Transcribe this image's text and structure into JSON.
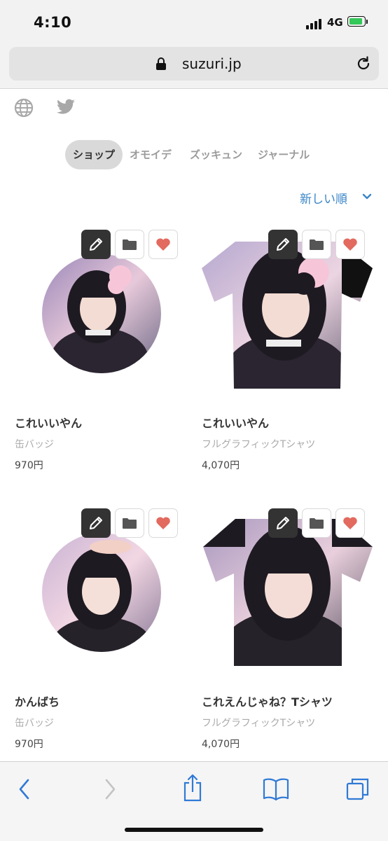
{
  "status": {
    "time": "4:10",
    "network": "4G"
  },
  "browser": {
    "url": "suzuri.jp"
  },
  "social": {
    "globe_icon": "globe-icon",
    "twitter_icon": "twitter-icon"
  },
  "tabs": [
    {
      "label": "ショップ",
      "active": true
    },
    {
      "label": "オモイデ",
      "active": false
    },
    {
      "label": "ズッキュン",
      "active": false
    },
    {
      "label": "ジャーナル",
      "active": false
    }
  ],
  "sort": {
    "label": "新しい順"
  },
  "products": [
    {
      "name": "これいいやん",
      "category": "缶バッジ",
      "price": "970円"
    },
    {
      "name": "これいいやん",
      "category": "フルグラフィックTシャツ",
      "price": "4,070円"
    },
    {
      "name": "かんばち",
      "category": "缶バッジ",
      "price": "970円"
    },
    {
      "name": "これえんじゃね？Tシャツ",
      "category": "フルグラフィックTシャツ",
      "price": "4,070円"
    }
  ],
  "colors": {
    "accent": "#3a86c8",
    "like": "#e26a5e",
    "edit_bg": "#333333",
    "tab_active_bg": "#d9d9d9"
  }
}
